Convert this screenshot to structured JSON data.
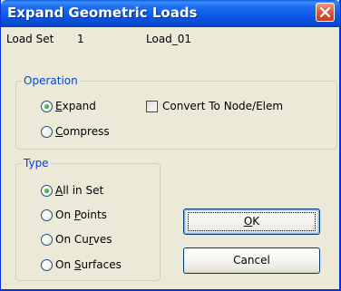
{
  "window": {
    "title": "Expand Geometric Loads",
    "close_icon": "close-icon"
  },
  "load_set": {
    "label": "Load Set",
    "id": "1",
    "name": "Load_01"
  },
  "operation": {
    "legend": "Operation",
    "options": [
      {
        "pre": "",
        "key": "E",
        "post": "xpand",
        "selected": true
      },
      {
        "pre": "",
        "key": "C",
        "post": "ompress",
        "selected": false
      }
    ],
    "convert_checkbox": {
      "label": "Convert To Node/Elem",
      "checked": false
    }
  },
  "type": {
    "legend": "Type",
    "options": [
      {
        "pre": "",
        "key": "A",
        "post": "ll in Set",
        "selected": true
      },
      {
        "pre": "On ",
        "key": "P",
        "post": "oints",
        "selected": false
      },
      {
        "pre": "On Cu",
        "key": "r",
        "post": "ves",
        "selected": false
      },
      {
        "pre": "On ",
        "key": "S",
        "post": "urfaces",
        "selected": false
      }
    ]
  },
  "buttons": {
    "ok": {
      "key": "O",
      "post": "K"
    },
    "cancel": {
      "label": "Cancel"
    }
  },
  "colors": {
    "titlebar": "#0a5fe0",
    "dialog_bg": "#ece9d8",
    "legend_text": "#0046d5",
    "close_button": "#e1593c",
    "radio_selected": "#21a121"
  }
}
